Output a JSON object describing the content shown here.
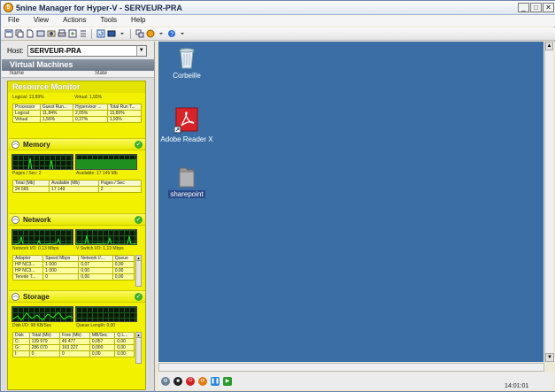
{
  "window": {
    "title": "5nine Manager for Hyper-V - SERVEUR-PRA",
    "app_icon_letter": "5"
  },
  "window_buttons": {
    "minimize": "_",
    "maximize": "□",
    "close": "✕"
  },
  "menu": [
    "File",
    "View",
    "Actions",
    "Tools",
    "Help"
  ],
  "host": {
    "label": "Host:",
    "value": "SERVEUR-PRA"
  },
  "vm_panel": {
    "title": "Virtual Machines",
    "col_name": "Name",
    "col_state": "State"
  },
  "resource_monitor": {
    "title": "Resource Monitor",
    "processor": {
      "logical_label": "Logical: 13,89%",
      "virtual_label": "Virtual: 1,93%",
      "columns": [
        "Processor",
        "Guest Run...",
        "Hypervisor ...",
        "Total Run T..."
      ],
      "rows": [
        [
          "Logical",
          "11,84%",
          "2,05%",
          "13,89%"
        ],
        [
          "Virtual",
          "1,56%",
          "0,37%",
          "1,93%"
        ]
      ]
    },
    "memory": {
      "title": "Memory",
      "pages_label": "Pages / Sec: 2",
      "available_label": "Available: 17 149 Mb",
      "columns": [
        "Total (Mb)",
        "Available (Mb)",
        "Pages / Sec"
      ],
      "rows": [
        [
          "24 565",
          "17 149",
          "2"
        ]
      ]
    },
    "network": {
      "title": "Network",
      "io_label": "Network I/O: 0,13 Mbps",
      "vswitch_label": "V Switch I/O: 1,13 Mbps",
      "columns": [
        "Adapter",
        "Speed Mbps",
        "Network I/...",
        "Queue"
      ],
      "rows": [
        [
          "HP NC3...",
          "1 000",
          "0,07",
          "0,00"
        ],
        [
          "HP NC3...",
          "1 000",
          "0,00",
          "0,00"
        ],
        [
          "Teredo T...",
          "0",
          "0,00",
          "0,00"
        ]
      ]
    },
    "storage": {
      "title": "Storage",
      "disk_label": "Disk I/O: 98 KB/Sec",
      "queue_label": "Queue Length: 0,00",
      "columns": [
        "Disk",
        "Total (Mb)",
        "Free (Mb)",
        "MB/Sec",
        "Q.L..."
      ],
      "rows": [
        [
          "C:",
          "139 979",
          "49 477",
          "0,057",
          "0,00"
        ],
        [
          "G:",
          "286 070",
          "163 227",
          "0,000",
          "0,00"
        ],
        [
          "I:",
          "0",
          "0",
          "0,00",
          "0,00"
        ]
      ]
    }
  },
  "desktop": {
    "background": "#3a6ea5",
    "icons": [
      {
        "label": "Corbeille",
        "icon": "recycle-bin-icon"
      },
      {
        "label": "Adobe Reader X",
        "icon": "adobe-reader-icon"
      },
      {
        "label": "sharepoint",
        "icon": "folder-icon"
      }
    ]
  },
  "status": {
    "time": "14:01:01"
  },
  "colors": {
    "monitor_yellow": "#f2f200",
    "graph_bg": "#0b1a0b",
    "graph_line": "#29e629",
    "desktop": "#3a6ea5"
  }
}
